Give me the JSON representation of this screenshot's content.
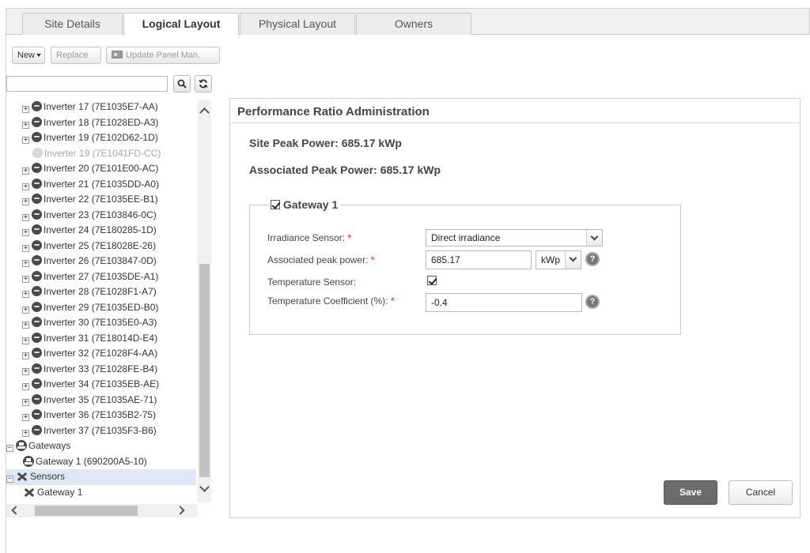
{
  "tabs": [
    {
      "label": "Site Details",
      "active": false
    },
    {
      "label": "Logical Layout",
      "active": true
    },
    {
      "label": "Physical Layout",
      "active": false
    },
    {
      "label": "Owners",
      "active": false
    }
  ],
  "toolbar": {
    "new_label": "New",
    "replace_label": "Replace",
    "update_panel_label": "Update Panel Man."
  },
  "search": {
    "value": "",
    "placeholder": ""
  },
  "tree": [
    {
      "label": "Inverter 17 (7E1035E7-AA)",
      "type": "inverter",
      "dim": false
    },
    {
      "label": "Inverter 18 (7E1028ED-A3)",
      "type": "inverter",
      "dim": false
    },
    {
      "label": "Inverter 19 (7E102D62-1D)",
      "type": "inverter",
      "dim": false
    },
    {
      "label": "Inverter 19 (7E1041FD-CC)",
      "type": "inverter",
      "dim": true
    },
    {
      "label": "Inverter 20 (7E101E00-AC)",
      "type": "inverter",
      "dim": false
    },
    {
      "label": "Inverter 21 (7E1035DD-A0)",
      "type": "inverter",
      "dim": false
    },
    {
      "label": "Inverter 22 (7E1035EE-B1)",
      "type": "inverter",
      "dim": false
    },
    {
      "label": "Inverter 23 (7E103846-0C)",
      "type": "inverter",
      "dim": false
    },
    {
      "label": "Inverter 24 (7E180285-1D)",
      "type": "inverter",
      "dim": false
    },
    {
      "label": "Inverter 25 (7E18028E-26)",
      "type": "inverter",
      "dim": false
    },
    {
      "label": "Inverter 26 (7E103847-0D)",
      "type": "inverter",
      "dim": false
    },
    {
      "label": "Inverter 27 (7E1035DE-A1)",
      "type": "inverter",
      "dim": false
    },
    {
      "label": "Inverter 28 (7E1028F1-A7)",
      "type": "inverter",
      "dim": false
    },
    {
      "label": "Inverter 29 (7E1035ED-B0)",
      "type": "inverter",
      "dim": false
    },
    {
      "label": "Inverter 30 (7E1035E0-A3)",
      "type": "inverter",
      "dim": false
    },
    {
      "label": "Inverter 31 (7E18014D-E4)",
      "type": "inverter",
      "dim": false
    },
    {
      "label": "Inverter 32 (7E1028F4-AA)",
      "type": "inverter",
      "dim": false
    },
    {
      "label": "Inverter 33 (7E1028FE-B4)",
      "type": "inverter",
      "dim": false
    },
    {
      "label": "Inverter 34 (7E1035EB-AE)",
      "type": "inverter",
      "dim": false
    },
    {
      "label": "Inverter 35 (7E1035AE-71)",
      "type": "inverter",
      "dim": false
    },
    {
      "label": "Inverter 36 (7E1035B2-75)",
      "type": "inverter",
      "dim": false
    },
    {
      "label": "Inverter 37 (7E1035F3-B6)",
      "type": "inverter",
      "dim": false
    },
    {
      "label": "Gateways",
      "type": "gateway-group",
      "dim": false
    },
    {
      "label": "Gateway 1 (690200A5-10)",
      "type": "gateway",
      "dim": false
    },
    {
      "label": "Sensors",
      "type": "sensor-group",
      "dim": false
    },
    {
      "label": "Gateway 1",
      "type": "sensor",
      "dim": false
    }
  ],
  "panel": {
    "title": "Performance Ratio Administration",
    "site_peak_power": "Site Peak Power: 685.17 kWp",
    "associated_peak_power": "Associated Peak Power: 685.17 kWp",
    "gateway_legend": "Gateway 1",
    "gateway_checked": true,
    "fields": {
      "irradiance_label": "Irradiance Sensor:",
      "irradiance_value": "Direct irradiance",
      "peak_power_label": "Associated peak power:",
      "peak_power_value": "685.17",
      "peak_power_unit": "kWp",
      "temp_sensor_label": "Temperature Sensor:",
      "temp_sensor_checked": true,
      "temp_coeff_label": "Temperature Coefficient (%):",
      "temp_coeff_value": "-0.4",
      "required_mark": "*",
      "help_glyph": "?"
    },
    "save_label": "Save",
    "cancel_label": "Cancel"
  },
  "colors": {
    "save_bg": "#6b6b6b",
    "required": "#e02020",
    "selected_row": "#dde8f6"
  }
}
